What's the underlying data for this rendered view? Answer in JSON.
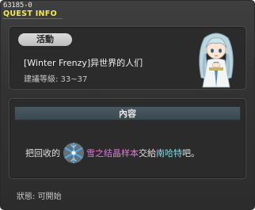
{
  "window": {
    "quest_id": "63185-0",
    "title": "QUEST INFO"
  },
  "summary": {
    "tag": "活動",
    "quest_name": "[Winter Frenzy]异世界的人们",
    "level_label": "建議等級: 33~37",
    "npc_icon": "ice-maiden-npc-portrait"
  },
  "content": {
    "tab_label": "內容",
    "desc_prefix": "把回收的",
    "item_icon": "snowflake-crystal-icon",
    "item_name": "雪之结晶样本",
    "desc_middle": "交給",
    "npc_name": "南哈特",
    "desc_suffix": "吧。"
  },
  "footer": {
    "status": "狀態: 可開始"
  },
  "colors": {
    "title": "#f3ec4a",
    "item_highlight": "#d27fd8",
    "npc_highlight": "#6fe0e0"
  }
}
